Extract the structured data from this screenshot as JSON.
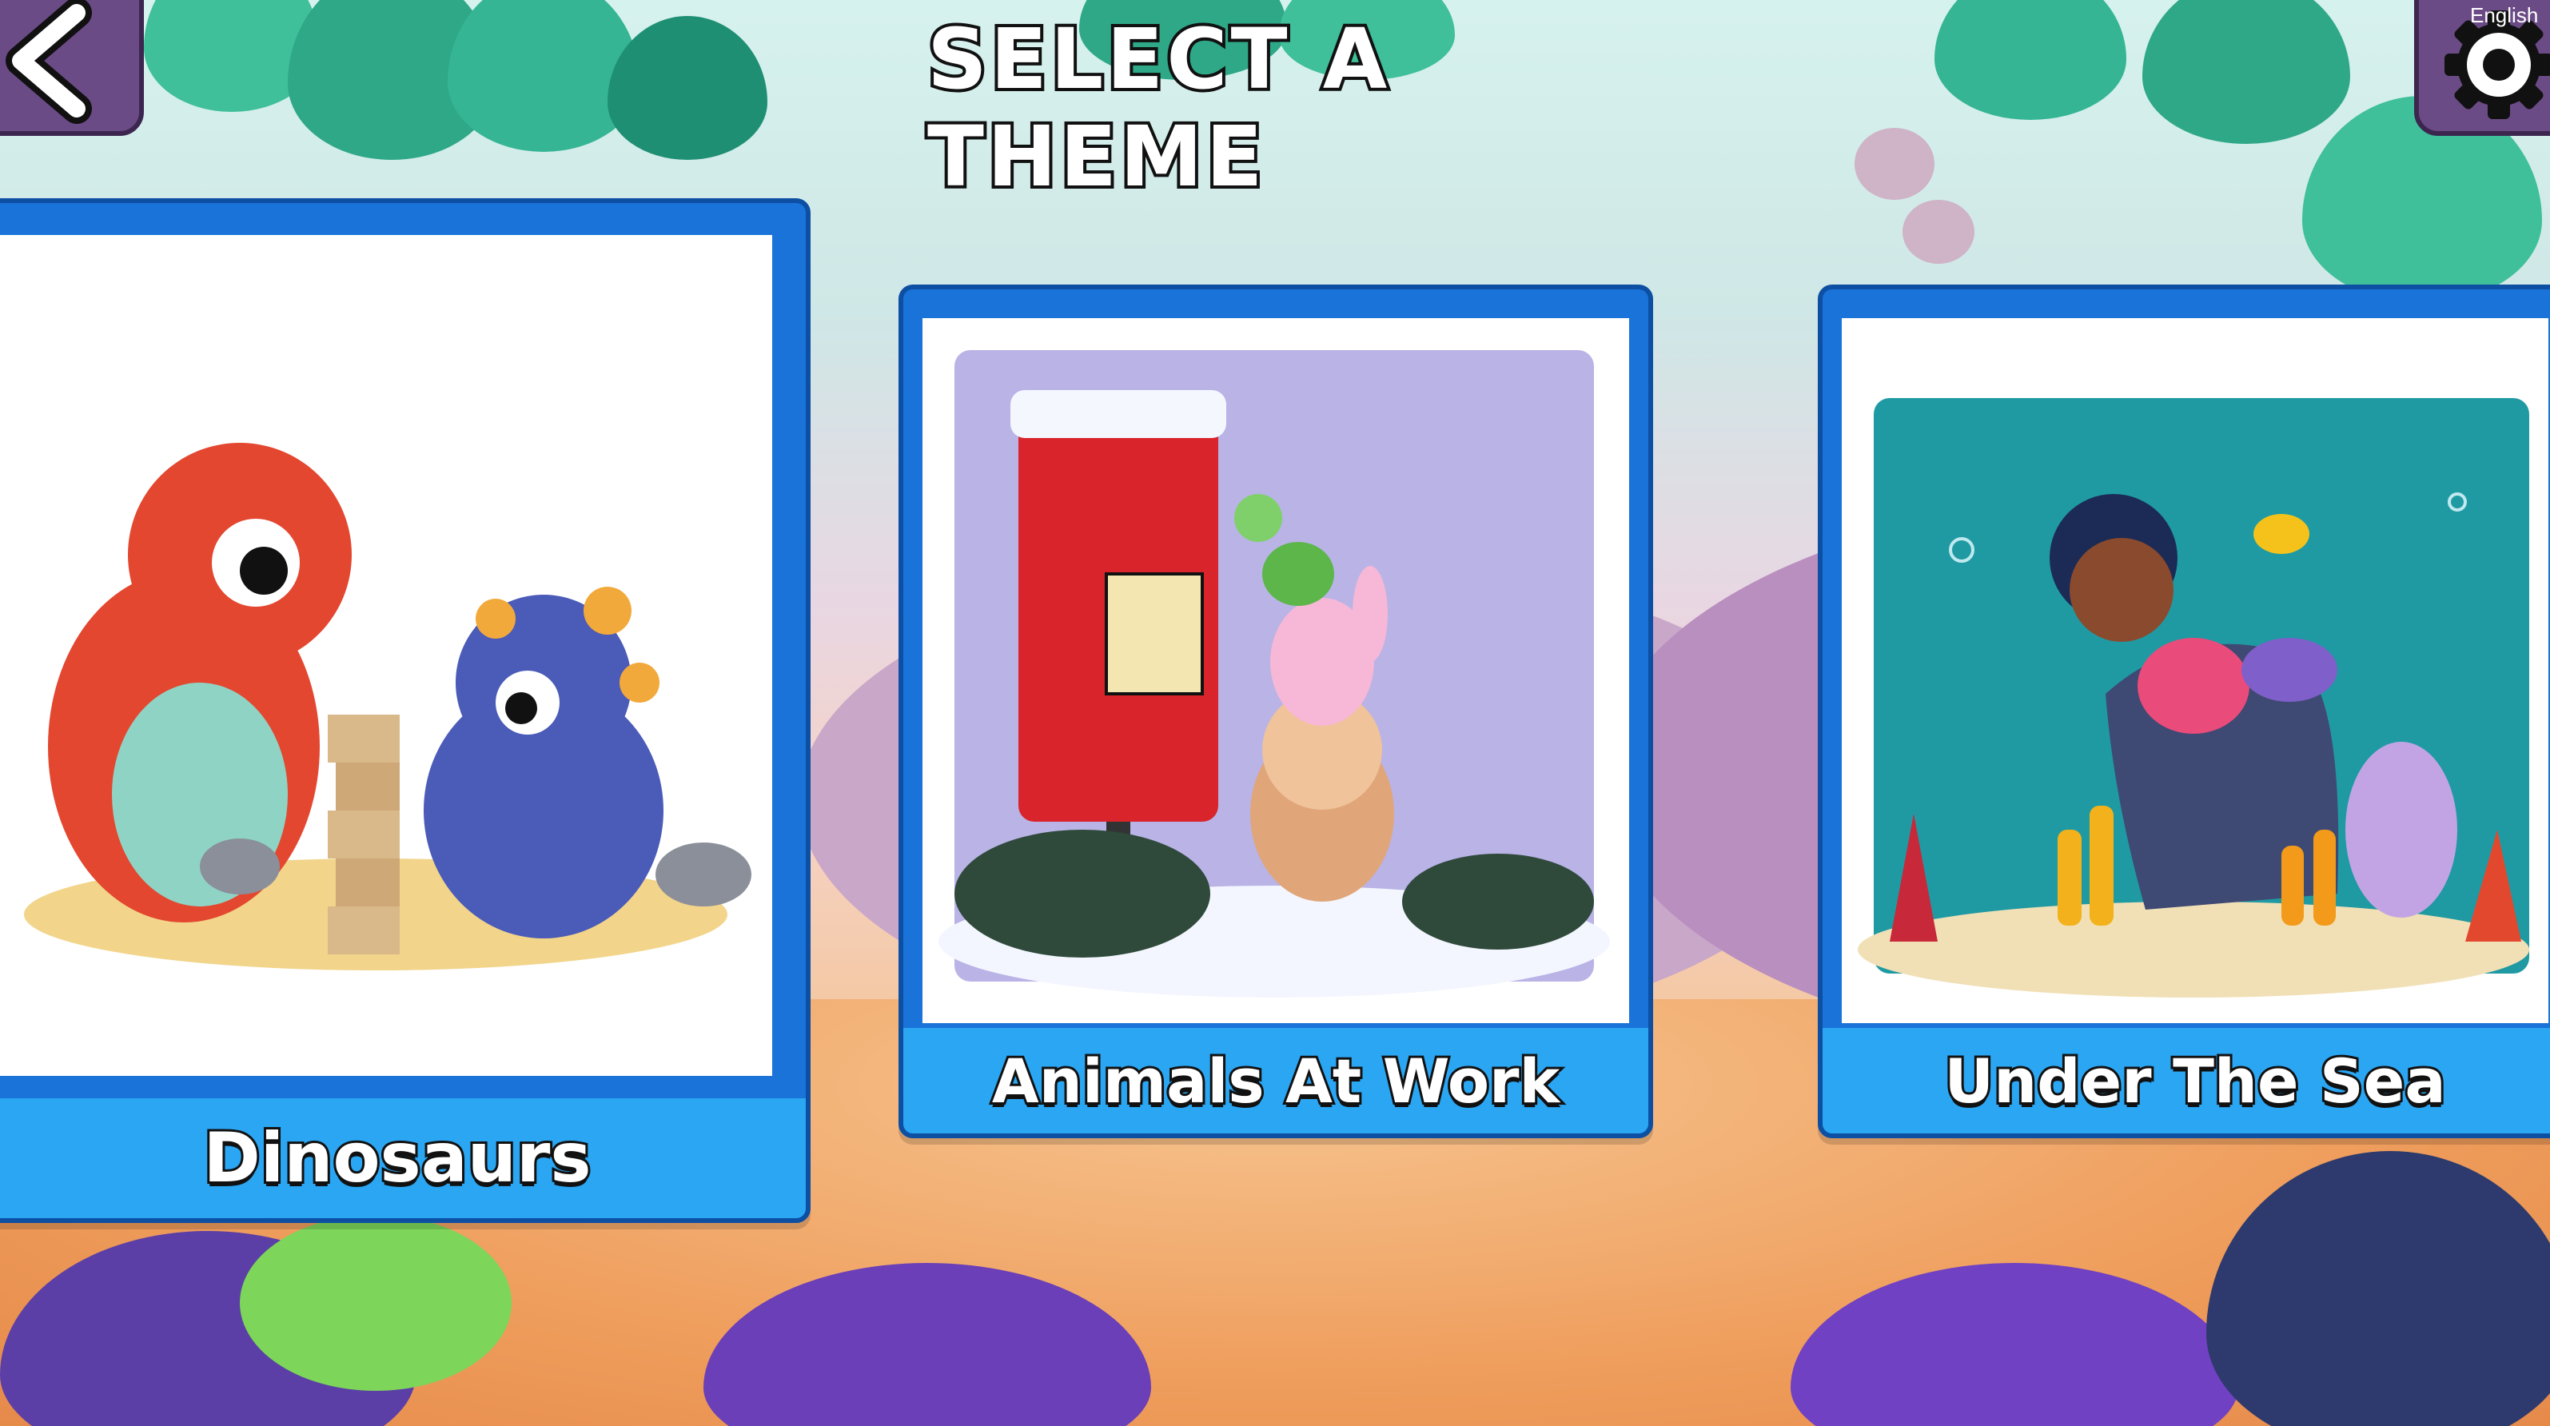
{
  "screen": {
    "title": "SELECT A THEME",
    "language_label": "English",
    "back_icon": "chevron-left-icon",
    "settings_icon": "gear-icon"
  },
  "themes": [
    {
      "label": "Dinosaurs",
      "selected": true
    },
    {
      "label": "Animals At Work",
      "selected": false
    },
    {
      "label": "Under The Sea",
      "selected": false
    }
  ],
  "colors": {
    "card_frame": "#1a73d8",
    "card_label_bg": "#2aa6f3",
    "button_bg": "#6b4b86",
    "title_text": "#ffffff"
  }
}
